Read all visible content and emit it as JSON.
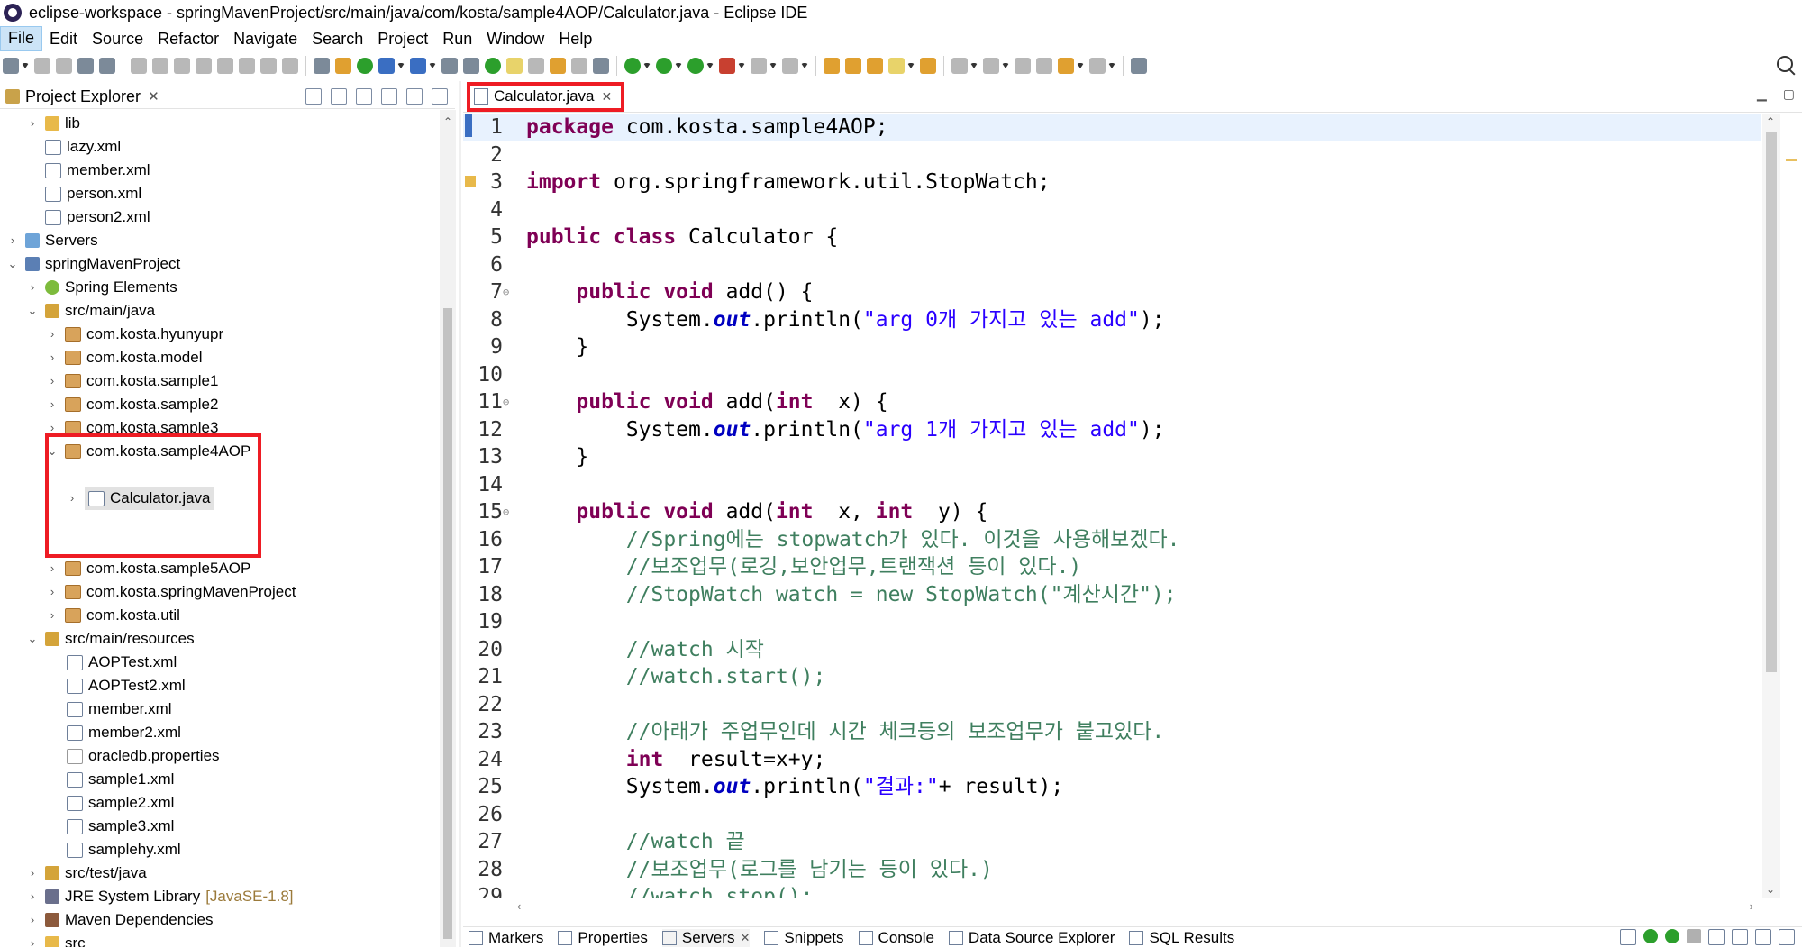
{
  "window": {
    "title": "eclipse-workspace - springMavenProject/src/main/java/com/kosta/sample4AOP/Calculator.java - Eclipse IDE"
  },
  "menu": [
    "File",
    "Edit",
    "Source",
    "Refactor",
    "Navigate",
    "Search",
    "Project",
    "Run",
    "Window",
    "Help"
  ],
  "project_explorer": {
    "title": "Project Explorer",
    "close": "✕",
    "items": [
      {
        "label": "lib",
        "icon": "folder-icon"
      },
      {
        "label": "lazy.xml",
        "icon": "xml-file-icon"
      },
      {
        "label": "member.xml",
        "icon": "xml-file-icon"
      },
      {
        "label": "person.xml",
        "icon": "xml-file-icon"
      },
      {
        "label": "person2.xml",
        "icon": "xml-file-icon"
      },
      {
        "label": "Servers",
        "icon": "servers-project-icon"
      },
      {
        "label": "springMavenProject",
        "icon": "project-icon"
      },
      {
        "label": "Spring Elements",
        "icon": "spring-icon"
      },
      {
        "label": "src/main/java",
        "icon": "source-folder-icon"
      },
      {
        "label": "com.kosta.hyunyupr",
        "icon": "package-icon"
      },
      {
        "label": "com.kosta.model",
        "icon": "package-icon"
      },
      {
        "label": "com.kosta.sample1",
        "icon": "package-icon"
      },
      {
        "label": "com.kosta.sample2",
        "icon": "package-icon"
      },
      {
        "label": "com.kosta.sample3",
        "icon": "package-icon"
      },
      {
        "label": "com.kosta.sample4AOP",
        "icon": "package-icon"
      },
      {
        "label": "Calculator.java",
        "icon": "java-file-icon"
      },
      {
        "label": "com.kosta.sample5AOP",
        "icon": "package-icon"
      },
      {
        "label": "com.kosta.springMavenProject",
        "icon": "package-icon"
      },
      {
        "label": "com.kosta.util",
        "icon": "package-icon"
      },
      {
        "label": "src/main/resources",
        "icon": "source-folder-icon"
      },
      {
        "label": "AOPTest.xml",
        "icon": "xml-file-icon"
      },
      {
        "label": "AOPTest2.xml",
        "icon": "spring-xml-icon"
      },
      {
        "label": "member.xml",
        "icon": "spring-xml-icon"
      },
      {
        "label": "member2.xml",
        "icon": "xml-file-icon"
      },
      {
        "label": "oracledb.properties",
        "icon": "properties-file-icon"
      },
      {
        "label": "sample1.xml",
        "icon": "spring-xml-icon"
      },
      {
        "label": "sample2.xml",
        "icon": "spring-xml-icon"
      },
      {
        "label": "sample3.xml",
        "icon": "spring-xml-icon"
      },
      {
        "label": "samplehy.xml",
        "icon": "spring-xml-icon"
      },
      {
        "label": "src/test/java",
        "icon": "source-folder-icon"
      },
      {
        "label": "JRE System Library",
        "tag": "[JavaSE-1.8]",
        "icon": "library-icon"
      },
      {
        "label": "Maven Dependencies",
        "icon": "library-icon"
      },
      {
        "label": "src",
        "icon": "folder-icon"
      }
    ]
  },
  "editor": {
    "tab_label": "Calculator.java",
    "tab_close": "✕",
    "lines": [
      {
        "n": "1",
        "segs": [
          [
            "kw",
            "package"
          ],
          [
            "",
            "com.kosta.sample4AOP;"
          ]
        ]
      },
      {
        "n": "2",
        "segs": []
      },
      {
        "n": "3",
        "segs": [
          [
            "kw",
            "import"
          ],
          [
            "",
            "org.springframework.util.StopWatch;"
          ]
        ]
      },
      {
        "n": "4",
        "segs": []
      },
      {
        "n": "5",
        "segs": [
          [
            "kw",
            "public class"
          ],
          [
            "",
            "Calculator {"
          ]
        ]
      },
      {
        "n": "6",
        "segs": []
      },
      {
        "n": "7",
        "segs": [
          [
            "",
            "    "
          ],
          [
            "kw",
            "public void"
          ],
          [
            "",
            "add() {"
          ]
        ]
      },
      {
        "n": "8",
        "segs": [
          [
            "",
            "        System."
          ],
          [
            "it",
            "out"
          ],
          [
            "",
            ".println("
          ],
          [
            "st",
            "\"arg 0개 가지고 있는 add\""
          ],
          [
            "",
            ");"
          ]
        ]
      },
      {
        "n": "9",
        "segs": [
          [
            "",
            "    }"
          ]
        ]
      },
      {
        "n": "10",
        "segs": []
      },
      {
        "n": "11",
        "segs": [
          [
            "",
            "    "
          ],
          [
            "kw",
            "public void"
          ],
          [
            "",
            "add("
          ],
          [
            "kw",
            "int"
          ],
          [
            "",
            " x) {"
          ]
        ]
      },
      {
        "n": "12",
        "segs": [
          [
            "",
            "        System."
          ],
          [
            "it",
            "out"
          ],
          [
            "",
            ".println("
          ],
          [
            "st",
            "\"arg 1개 가지고 있는 add\""
          ],
          [
            "",
            ");"
          ]
        ]
      },
      {
        "n": "13",
        "segs": [
          [
            "",
            "    }"
          ]
        ]
      },
      {
        "n": "14",
        "segs": []
      },
      {
        "n": "15",
        "segs": [
          [
            "",
            "    "
          ],
          [
            "kw",
            "public void"
          ],
          [
            "",
            "add("
          ],
          [
            "kw",
            "int"
          ],
          [
            "",
            " x, "
          ],
          [
            "kw",
            "int"
          ],
          [
            "",
            " y) {"
          ]
        ]
      },
      {
        "n": "16",
        "segs": [
          [
            "cm",
            "        //Spring에는 stopwatch가 있다. 이것을 사용해보겠다."
          ]
        ]
      },
      {
        "n": "17",
        "segs": [
          [
            "cm",
            "        //보조업무(로깅,보안업무,트랜잭션 등이 있다.)"
          ]
        ]
      },
      {
        "n": "18",
        "segs": [
          [
            "cm",
            "        //StopWatch watch = new StopWatch(\"계산시간\");"
          ]
        ]
      },
      {
        "n": "19",
        "segs": []
      },
      {
        "n": "20",
        "segs": [
          [
            "cm",
            "        //watch 시작"
          ]
        ]
      },
      {
        "n": "21",
        "segs": [
          [
            "cm",
            "        //watch.start();"
          ]
        ]
      },
      {
        "n": "22",
        "segs": []
      },
      {
        "n": "23",
        "segs": [
          [
            "cm",
            "        //아래가 주업무인데 시간 체크등의 보조업무가 붙고있다."
          ]
        ]
      },
      {
        "n": "24",
        "segs": [
          [
            "",
            "        "
          ],
          [
            "kw",
            "int"
          ],
          [
            "",
            " result=x+y;"
          ]
        ]
      },
      {
        "n": "25",
        "segs": [
          [
            "",
            "        System."
          ],
          [
            "it",
            "out"
          ],
          [
            "",
            ".println("
          ],
          [
            "st",
            "\"결과:\""
          ],
          [
            "",
            "+ result);"
          ]
        ]
      },
      {
        "n": "26",
        "segs": []
      },
      {
        "n": "27",
        "segs": [
          [
            "cm",
            "        //watch 끝"
          ]
        ]
      },
      {
        "n": "28",
        "segs": [
          [
            "cm",
            "        //보조업무(로그를 남기는 등이 있다.)"
          ]
        ]
      },
      {
        "n": "29",
        "segs": [
          [
            "cm",
            "        //watch.stop();"
          ]
        ]
      }
    ]
  },
  "bottom_tabs": [
    "Markers",
    "Properties",
    "Servers",
    "Snippets",
    "Console",
    "Data Source Explorer",
    "SQL Results"
  ],
  "colors": {
    "highlight": "#ee1c24",
    "keyword": "#7f0055",
    "string": "#2a00ff",
    "comment": "#3f7f5f"
  }
}
